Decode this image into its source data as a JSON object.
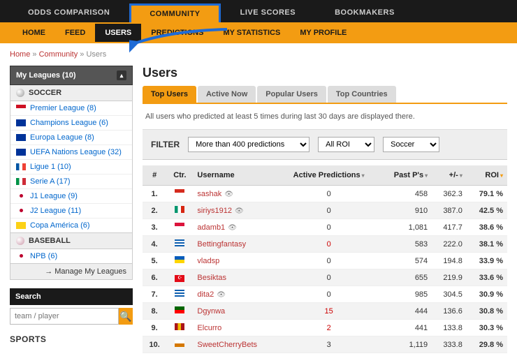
{
  "topnav": {
    "items": [
      {
        "label": "ODDS COMPARISON"
      },
      {
        "label": "COMMUNITY",
        "highlight": true
      },
      {
        "label": "LIVE SCORES"
      },
      {
        "label": "BOOKMAKERS"
      }
    ]
  },
  "subnav": {
    "items": [
      {
        "label": "HOME"
      },
      {
        "label": "FEED"
      },
      {
        "label": "USERS",
        "active": true
      },
      {
        "label": "PREDICTIONS"
      },
      {
        "label": "MY STATISTICS"
      },
      {
        "label": "MY PROFILE"
      }
    ]
  },
  "breadcrumbs": {
    "home": "Home",
    "community": "Community",
    "users": "Users",
    "sep": "»"
  },
  "sidebar": {
    "leagues_title": "My Leagues (10)",
    "soccer_label": "SOCCER",
    "baseball_label": "BASEBALL",
    "soccer": [
      {
        "label": "Premier League (8)",
        "flag": "#ce1124",
        "flag2": "#fff"
      },
      {
        "label": "Champions League (6)",
        "flag": "#003399"
      },
      {
        "label": "Europa League (8)",
        "flag": "#003399"
      },
      {
        "label": "UEFA Nations League (32)",
        "flag": "#003399"
      },
      {
        "label": "Ligue 1 (10)",
        "flag": "#0055a4",
        "flag2": "#fff",
        "flag3": "#ef4135"
      },
      {
        "label": "Serie A (17)",
        "flag": "#009246",
        "flag2": "#fff",
        "flag3": "#ce2b37"
      },
      {
        "label": "J1 League (9)",
        "flag": "#fff",
        "dot": "#bc002d"
      },
      {
        "label": "J2 League (11)",
        "flag": "#fff",
        "dot": "#bc002d"
      },
      {
        "label": "Copa América (6)",
        "flag": "#fcd116"
      }
    ],
    "baseball": [
      {
        "label": "NPB (6)",
        "flag": "#fff",
        "dot": "#bc002d"
      }
    ],
    "manage": "→ Manage My Leagues",
    "search_label": "Search",
    "search_placeholder": "team / player",
    "sports_label": "SPORTS"
  },
  "main": {
    "title": "Users",
    "tabs": [
      {
        "label": "Top Users",
        "sel": true
      },
      {
        "label": "Active Now"
      },
      {
        "label": "Popular Users"
      },
      {
        "label": "Top Countries"
      }
    ],
    "intro": "All users who predicted at least 5 times during last 30 days are displayed there.",
    "filter": {
      "label": "FILTER",
      "s1": "More than 400 predictions",
      "s2": "All ROI",
      "s3": "Soccer"
    },
    "headers": {
      "rank": "#",
      "ctr": "Ctr.",
      "user": "Username",
      "active": "Active Predictions",
      "past": "Past P's",
      "pm": "+/-",
      "roi": "ROI"
    },
    "rows": [
      {
        "rank": "1.",
        "flag": "#d52b1e",
        "flag2": "#fff",
        "user": "sashak",
        "eye": true,
        "active": "0",
        "past": "458",
        "pm": "362.3",
        "roi": "79.1 %"
      },
      {
        "rank": "2.",
        "flag": "#00966e",
        "flag2": "#fff",
        "flag3": "#d62612",
        "user": "siriys1912",
        "eye": true,
        "active": "0",
        "past": "910",
        "pm": "387.0",
        "roi": "42.5 %"
      },
      {
        "rank": "3.",
        "flag": "#dc143c",
        "flag2": "#fff",
        "user": "adamb1",
        "eye": true,
        "active": "0",
        "past": "1,081",
        "pm": "417.7",
        "roi": "38.6 %"
      },
      {
        "rank": "4.",
        "flag": "#0d5eaf",
        "stripes": true,
        "user": "Bettingfantasy",
        "active": "0",
        "ared": true,
        "past": "583",
        "pm": "222.0",
        "roi": "38.1 %"
      },
      {
        "rank": "5.",
        "flag": "#005bbb",
        "flag2": "#ffd500",
        "user": "vladsp",
        "active": "0",
        "past": "574",
        "pm": "194.8",
        "roi": "33.9 %"
      },
      {
        "rank": "6.",
        "flag": "#e30a17",
        "moon": true,
        "user": "Besiktas",
        "active": "0",
        "past": "655",
        "pm": "219.9",
        "roi": "33.6 %"
      },
      {
        "rank": "7.",
        "flag": "#0d5eaf",
        "stripes": true,
        "user": "dita2",
        "eye": true,
        "active": "0",
        "past": "985",
        "pm": "304.5",
        "roi": "30.9 %"
      },
      {
        "rank": "8.",
        "flag": "#006600",
        "flag2": "#ff0000",
        "user": "Dgynwa",
        "active": "15",
        "ared": true,
        "past": "444",
        "pm": "136.6",
        "roi": "30.8 %"
      },
      {
        "rank": "9.",
        "flag": "#aa151b",
        "flag2": "#f1bf00",
        "flag3": "#aa151b",
        "user": "Elcurro",
        "active": "2",
        "ared": true,
        "past": "441",
        "pm": "133.8",
        "roi": "30.3 %"
      },
      {
        "rank": "10.",
        "flag": "#fff",
        "flag2": "#d57800",
        "user": "SweetCherryBets",
        "active": "3",
        "past": "1,119",
        "pm": "333.8",
        "roi": "29.8 %"
      }
    ]
  }
}
